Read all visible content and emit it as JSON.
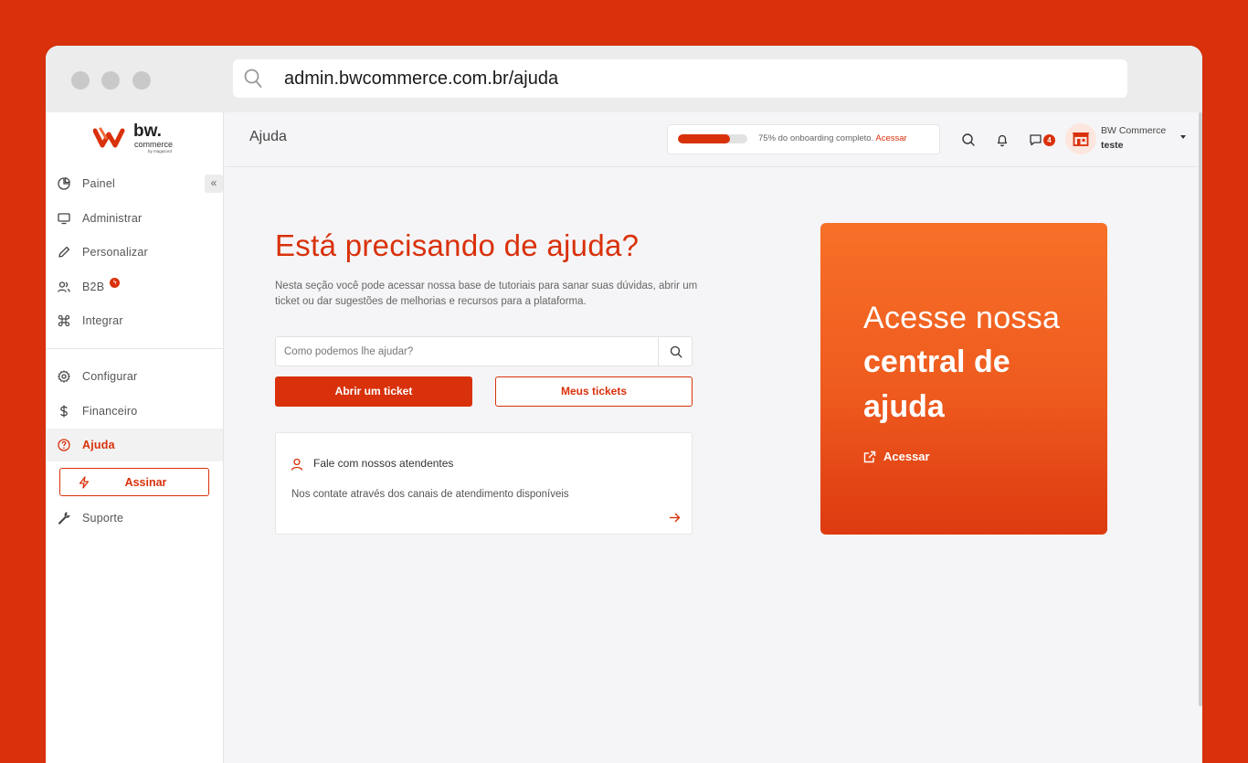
{
  "browser": {
    "url": "admin.bwcommerce.com.br/ajuda"
  },
  "brand": {
    "logo_text": "bw.",
    "logo_sub": "commerce",
    "logo_tag": "by magazord",
    "accent": "#d9310b"
  },
  "sidebar": {
    "items": [
      {
        "label": "Painel",
        "icon": "pie-chart-icon"
      },
      {
        "label": "Administrar",
        "icon": "monitor-icon"
      },
      {
        "label": "Personalizar",
        "icon": "pencil-icon"
      },
      {
        "label": "B2B",
        "icon": "users-icon",
        "badge": "lightning-badge"
      },
      {
        "label": "Integrar",
        "icon": "command-icon"
      },
      {
        "label": "Configurar",
        "icon": "gear-icon"
      },
      {
        "label": "Financeiro",
        "icon": "dollar-icon"
      },
      {
        "label": "Ajuda",
        "icon": "help-circle-icon",
        "active": true
      },
      {
        "label": "Suporte",
        "icon": "wrench-icon"
      }
    ],
    "assinar_label": "Assinar",
    "collapse_glyph": "«"
  },
  "header": {
    "title": "Ajuda",
    "onboarding": {
      "progress": 0.75,
      "text": "75% do onboarding completo.",
      "link": "Acessar"
    },
    "messages_count": "4",
    "user": {
      "name": "BW Commerce",
      "store": "teste"
    }
  },
  "main": {
    "title": "Está precisando de ajuda?",
    "description": "Nesta seção você pode acessar nossa base de tutoriais para sanar suas dúvidas, abrir um ticket ou dar sugestões de melhorias e recursos para a plataforma.",
    "search_placeholder": "Como podemos lhe ajudar?",
    "open_ticket_label": "Abrir um ticket",
    "my_tickets_label": "Meus tickets",
    "contact_card": {
      "title": "Fale com nossos atendentes",
      "description": "Nos contate através dos canais de atendimento disponíveis"
    }
  },
  "help_center": {
    "line1": "Acesse nossa",
    "line2": "central de",
    "line3": "ajuda",
    "link_label": "Acessar"
  }
}
